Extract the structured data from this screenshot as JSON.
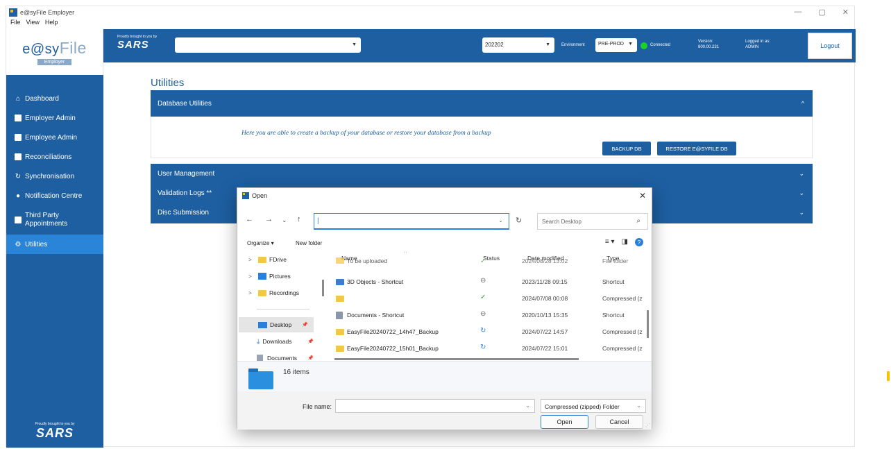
{
  "window": {
    "title": "e@syFile Employer",
    "controls": [
      "—",
      "▢",
      "✕"
    ],
    "menu": [
      "File",
      "View",
      "Help"
    ]
  },
  "sidebar": {
    "logo": {
      "text_left": "e@sy",
      "text_right": "File",
      "sub": "Employer"
    },
    "items": [
      {
        "label": "Dashboard",
        "icon": "home-icon",
        "glyph": "⌂"
      },
      {
        "label": "Employer Admin",
        "icon": "clipboard-icon",
        "glyph": ""
      },
      {
        "label": "Employee Admin",
        "icon": "clipboard-icon",
        "glyph": ""
      },
      {
        "label": "Reconciliations",
        "icon": "edit-document-icon",
        "glyph": ""
      },
      {
        "label": "Synchronisation",
        "icon": "sync-icon",
        "glyph": "↻"
      },
      {
        "label": "Notification Centre",
        "icon": "info-circle-icon",
        "glyph": "●"
      },
      {
        "label": "Third Party Appointments",
        "icon": "briefcase-icon",
        "glyph": ""
      },
      {
        "label": "Utilities",
        "icon": "gears-icon",
        "glyph": "⚙"
      }
    ],
    "active_item": "Utilities",
    "footer": {
      "tiny": "Proudly brought to you by",
      "brand": "SARS"
    }
  },
  "header": {
    "tiny": "Proudly brought to you by",
    "brand": "SARS",
    "employer_select": "",
    "period_select": "202202",
    "environment_label": "Environment",
    "environment_value": "PRE-PROD",
    "status": "Connected",
    "status_color": "#1bd12b",
    "version_label": "Version:",
    "version_value": "800.00.231",
    "logged_label": "Logged in as:",
    "logged_value": "ADMIN",
    "logout": "Logout"
  },
  "main": {
    "title": "Utilities",
    "database_utilities": {
      "label": "Database Utilities",
      "chevron": "^",
      "description": "Here you are able to create a backup of your database or restore your database from a backup",
      "backup_button": "BACKUP DB",
      "restore_button": "RESTORE E@SYFILE DB"
    },
    "sections": [
      {
        "label": "User Management",
        "chevron": "⌄"
      },
      {
        "label": "Validation Logs **",
        "chevron": "⌄"
      },
      {
        "label": "Disc Submission",
        "chevron": "⌄"
      }
    ]
  },
  "dialog": {
    "title": "Open",
    "close": "✕",
    "address_value": "|",
    "search_placeholder": "Search Desktop",
    "organize": "Organize ▾",
    "new_folder": "New folder",
    "nav_tree": [
      {
        "label": "FDrive",
        "kind": "folder",
        "arrow": ">"
      },
      {
        "label": "Pictures",
        "kind": "pictures",
        "arrow": ">"
      },
      {
        "label": "Recordings",
        "kind": "folder",
        "arrow": ">"
      }
    ],
    "quick_access": [
      {
        "label": "Desktop",
        "kind": "desktop",
        "selected": true
      },
      {
        "label": "Downloads",
        "kind": "downloads",
        "selected": false
      },
      {
        "label": "Documents",
        "kind": "documents",
        "selected": false
      }
    ],
    "columns": {
      "name": "Name",
      "status": "Status",
      "date": "Date modified",
      "type": "Type"
    },
    "files": [
      {
        "name": "To be uploaded",
        "status": "ok",
        "date": "2024/08/28 13:02",
        "type": "File folder",
        "icon": "folder",
        "partial": true
      },
      {
        "name": "3D Objects - Shortcut",
        "status": "cloud",
        "date": "2023/11/28 09:15",
        "type": "Shortcut",
        "icon": "shortcut",
        "partial": false
      },
      {
        "name": "",
        "status": "ok",
        "date": "2024/07/08 00:08",
        "type": "Compressed (z",
        "icon": "folder",
        "partial": false
      },
      {
        "name": "Documents - Shortcut",
        "status": "cloud",
        "date": "2020/10/13 15:35",
        "type": "Shortcut",
        "icon": "doc",
        "partial": false
      },
      {
        "name": "EasyFile20240722_14h47_Backup",
        "status": "sync",
        "date": "2024/07/22 14:57",
        "type": "Compressed (z",
        "icon": "folder",
        "partial": false
      },
      {
        "name": "EasyFile20240722_15h01_Backup",
        "status": "sync",
        "date": "2024/07/22 15:01",
        "type": "Compressed (z",
        "icon": "folder",
        "partial": false
      }
    ],
    "item_count": "16 items",
    "file_name_label": "File name:",
    "file_name_value": "",
    "file_type": "Compressed (zipped) Folder",
    "open_button": "Open",
    "cancel_button": "Cancel"
  },
  "colors": {
    "brand_blue": "#1d5fa1",
    "active_blue": "#2a84d8",
    "accent_yellow": "#f2c400"
  }
}
